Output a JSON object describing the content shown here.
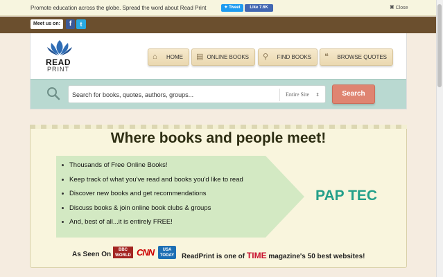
{
  "promo": {
    "text": "Promote education across the globe. Spread the word about Read Print",
    "tweet_label": "Tweet",
    "like_label": "Like 7.6K",
    "close_label": "Close"
  },
  "social": {
    "meet_label": "Meet us on:",
    "facebook_icon": "facebook-icon",
    "twitter_icon": "twitter-icon"
  },
  "logo": {
    "line1": "READ",
    "line2": "PRINT",
    "color": "#2f6db5"
  },
  "nav": {
    "items": [
      {
        "label": "HOME",
        "icon": "house-icon"
      },
      {
        "label": "ONLINE BOOKS",
        "icon": "book-icon"
      },
      {
        "label": "FIND BOOKS",
        "icon": "magnifier-icon"
      },
      {
        "label": "BROWSE QUOTES",
        "icon": "quote-icon"
      }
    ]
  },
  "search": {
    "placeholder": "Search for books, quotes, authors, groups...",
    "scope_value": "Entire Site",
    "button_label": "Search",
    "button_color": "#df8471"
  },
  "hero": {
    "title": "Where books and people meet!",
    "features": [
      "Thousands of Free Online Books!",
      "Keep track of what you've read and books you'd like to read",
      "Discover new books and get recommendations",
      "Discuss books & join online book clubs & groups",
      "And, best of all...it is entirely FREE!"
    ],
    "ad_text": "PAP TEC",
    "seen_on": "As Seen On",
    "bbc_text": "BBC WORLD",
    "cnn_text": "CNN",
    "usatoday_text": "USA TODAY",
    "readprint_pre": "ReadPrint is one of",
    "time_text": "TIME",
    "readprint_post": "magazine's 50 best websites!"
  }
}
